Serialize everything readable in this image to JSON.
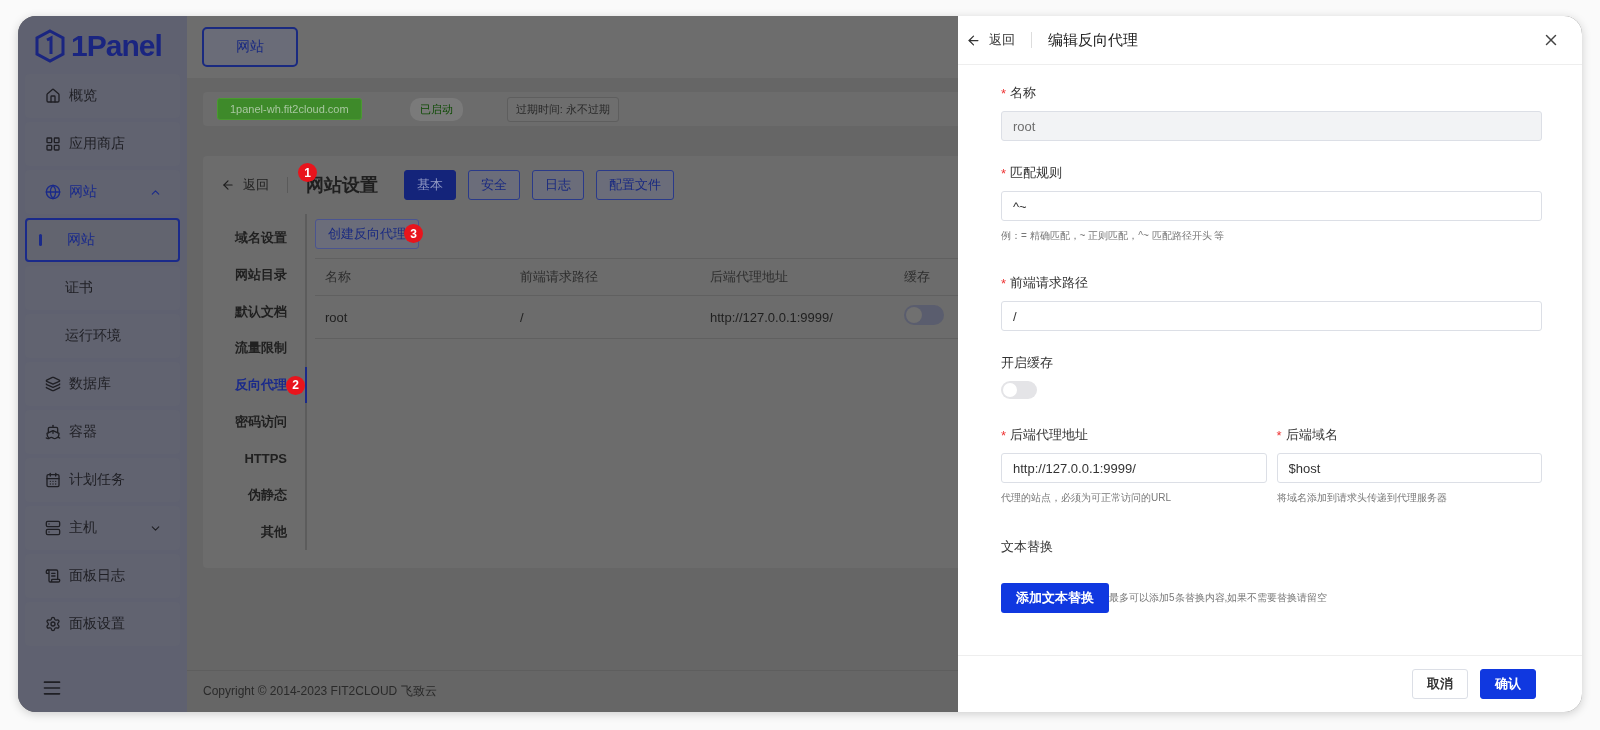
{
  "logo": {
    "text": "1Panel"
  },
  "sidebar": {
    "items": [
      {
        "label": "概览",
        "selected": false
      },
      {
        "label": "应用商店",
        "selected": false
      },
      {
        "label": "网站",
        "selected": true,
        "expanded": true,
        "children": [
          {
            "label": "网站",
            "selected": true
          },
          {
            "label": "证书",
            "selected": false
          },
          {
            "label": "运行环境",
            "selected": false
          }
        ]
      },
      {
        "label": "数据库",
        "selected": false
      },
      {
        "label": "容器",
        "selected": false
      },
      {
        "label": "计划任务",
        "selected": false
      },
      {
        "label": "主机",
        "selected": false,
        "expanded": false
      },
      {
        "label": "面板日志",
        "selected": false
      },
      {
        "label": "面板设置",
        "selected": false
      }
    ]
  },
  "top_tabs": [
    {
      "label": "网站",
      "selected": true
    }
  ],
  "site_info": {
    "domain": "1panel-wh.fit2cloud.com",
    "status": "已启动",
    "expiry": "过期时间: 永不过期"
  },
  "settings": {
    "back": "返回",
    "title": {
      "text": "网站设置",
      "marker": "1"
    },
    "tabs": [
      {
        "label": "基本",
        "selected": true
      },
      {
        "label": "安全",
        "selected": false
      },
      {
        "label": "日志",
        "selected": false
      },
      {
        "label": "配置文件",
        "selected": false
      }
    ],
    "menu": [
      {
        "label": "域名设置",
        "selected": false
      },
      {
        "label": "网站目录",
        "selected": false
      },
      {
        "label": "默认文档",
        "selected": false
      },
      {
        "label": "流量限制",
        "selected": false
      },
      {
        "label": "反向代理",
        "selected": true,
        "marker": "2"
      },
      {
        "label": "密码访问",
        "selected": false
      },
      {
        "label": "HTTPS",
        "selected": false
      },
      {
        "label": "伪静态",
        "selected": false
      },
      {
        "label": "其他",
        "selected": false
      }
    ],
    "create_button": {
      "label": "创建反向代理",
      "marker": "3"
    },
    "table": {
      "columns": [
        "名称",
        "前端请求路径",
        "后端代理地址",
        "缓存"
      ],
      "rows": [
        {
          "cells": [
            "root",
            "/",
            "http://127.0.0.1:9999/"
          ],
          "cache_on": false
        }
      ]
    }
  },
  "footer": "Copyright © 2014-2023 FIT2CLOUD 飞致云",
  "drawer": {
    "back": "返回",
    "title": "编辑反向代理",
    "fields": [
      {
        "label": "名称",
        "required_mark": "*",
        "value": "root",
        "disabled": true
      },
      {
        "label": "匹配规则",
        "required_mark": "*",
        "value": "^~",
        "disabled": false,
        "hint": "例：= 精确匹配，~ 正则匹配，^~ 匹配路径开头 等"
      },
      {
        "label": "前端请求路径",
        "required_mark": "*",
        "value": "/",
        "disabled": false
      }
    ],
    "cache": {
      "label": "开启缓存",
      "on": false
    },
    "backend_fields": [
      {
        "label": "后端代理地址",
        "required_mark": "*",
        "value": "http://127.0.0.1:9999/",
        "hint": "代理的站点，必须为可正常访问的URL"
      },
      {
        "label": "后端域名",
        "required_mark": "*",
        "value": "$host",
        "hint": "将域名添加到请求头传递到代理服务器"
      }
    ],
    "replace": {
      "label": "文本替换",
      "button": "添加文本替换",
      "note": "最多可以添加5条替换内容,如果不需要替换请留空"
    },
    "buttons": [
      {
        "label": "取消",
        "kind": "default"
      },
      {
        "label": "确认",
        "kind": "primary"
      }
    ]
  }
}
